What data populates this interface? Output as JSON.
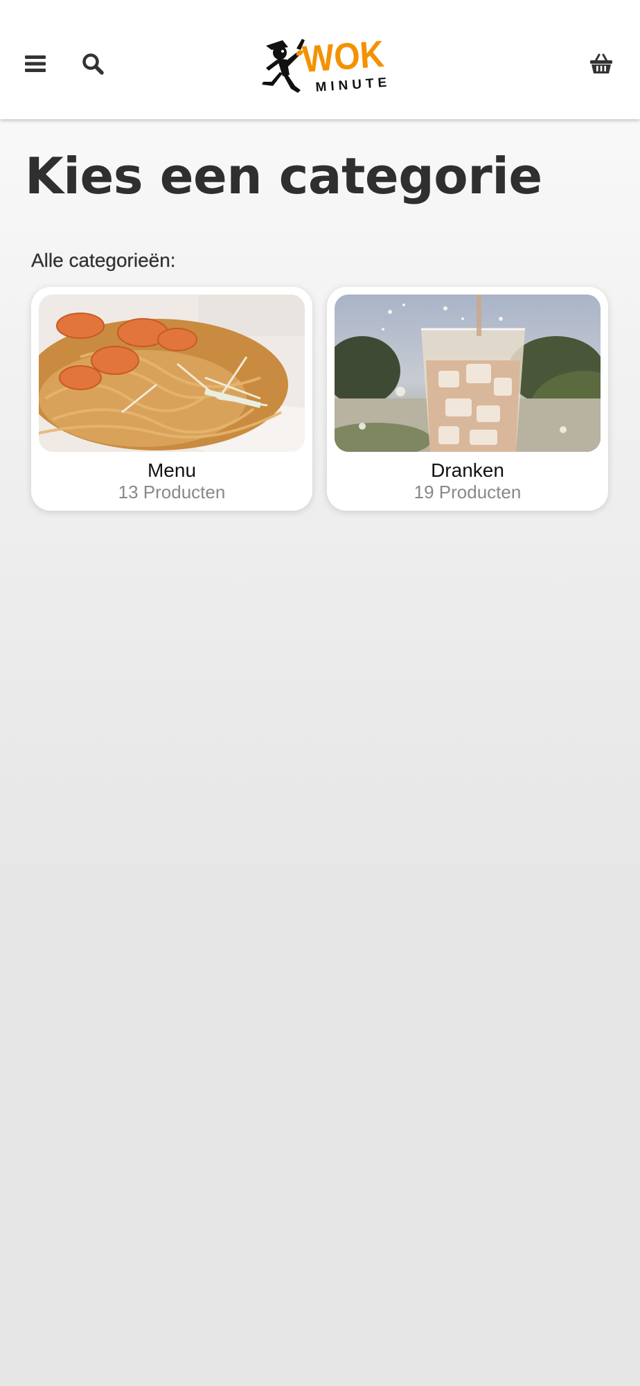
{
  "header": {
    "logo_text_main": "WOK",
    "logo_text_sub": "MINUTE",
    "icons": {
      "menu": "hamburger-menu-icon",
      "search": "search-icon",
      "cart": "shopping-basket-icon"
    }
  },
  "main": {
    "title": "Kies een categorie",
    "section_label": "Alle categorieën:",
    "categories": [
      {
        "name": "Menu",
        "count": "13 Producten",
        "image": "pad-thai-shrimp-noodles"
      },
      {
        "name": "Dranken",
        "count": "19 Producten",
        "image": "glass-of-sparkling-drink"
      }
    ]
  },
  "colors": {
    "brand_orange": "#f39200",
    "text_dark": "#2f2f2f",
    "text_muted": "#888888",
    "card_bg": "#ffffff"
  }
}
